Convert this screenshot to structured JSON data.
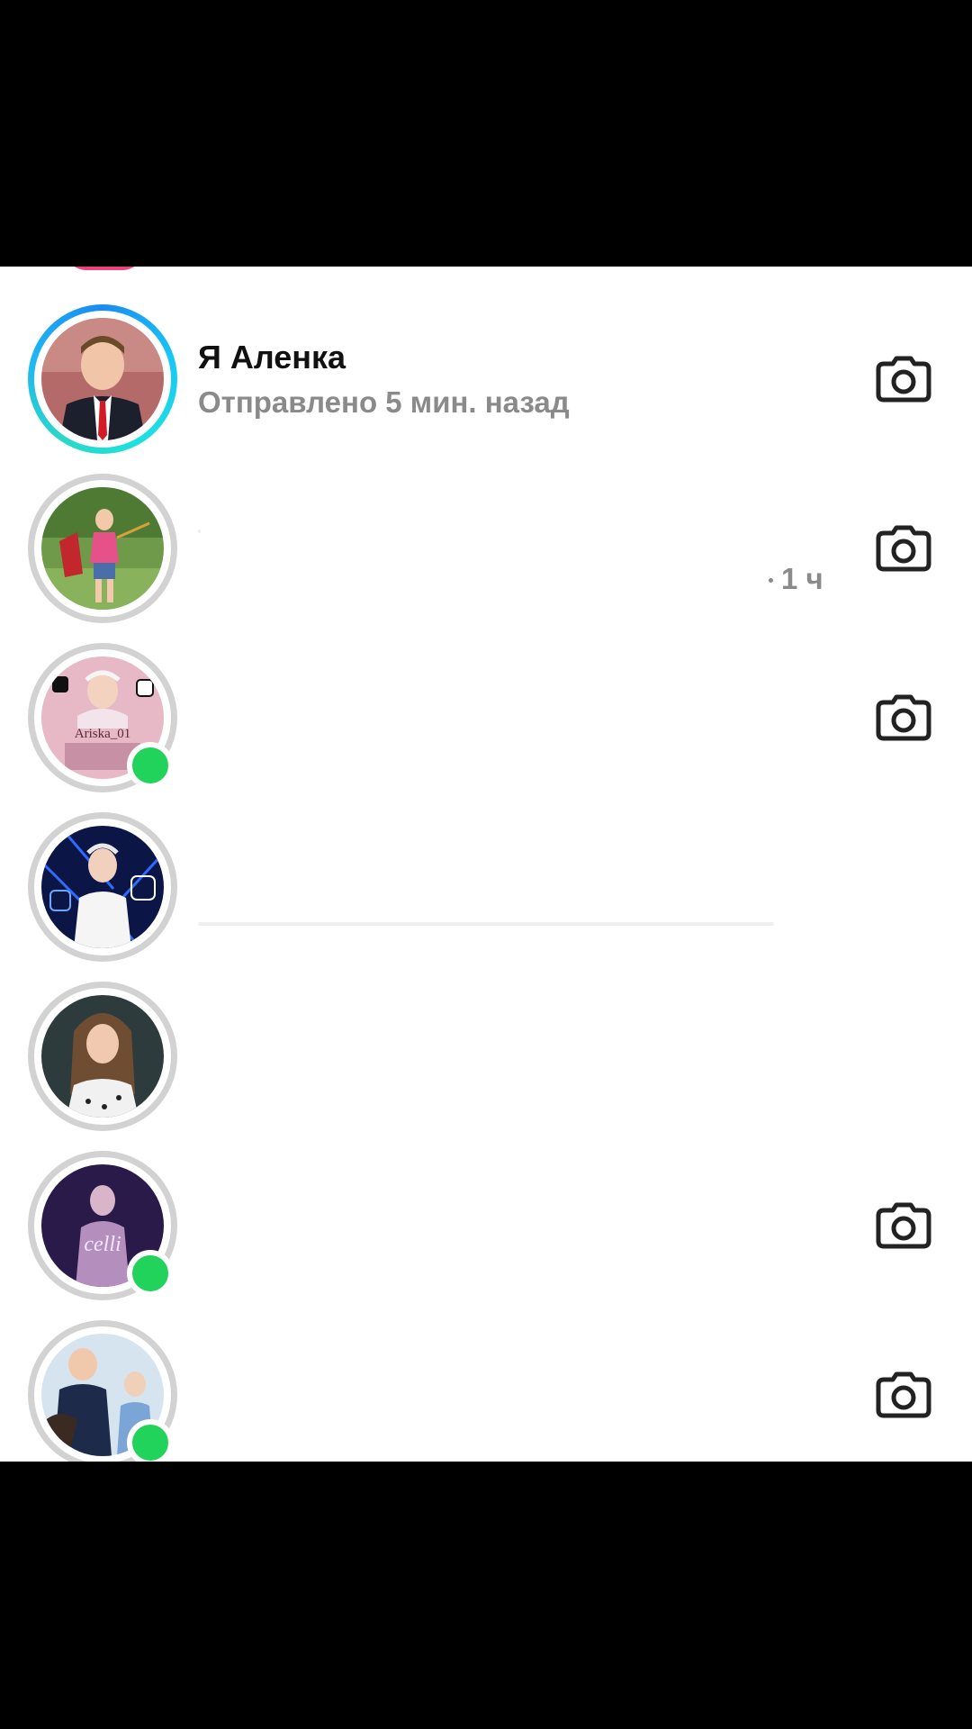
{
  "chats": [
    {
      "name": "Я Аленка",
      "status": "Отправлено 5 мин. назад",
      "time": "",
      "ring": "story",
      "online": false,
      "camera": true,
      "avatar_icon": "boy-in-suit-photo"
    },
    {
      "name": "",
      "status": "",
      "time": "1 ч",
      "ring": "grey",
      "online": false,
      "camera": true,
      "avatar_icon": "girl-archery-photo"
    },
    {
      "name": "",
      "status": "",
      "time": "",
      "ring": "grey",
      "online": true,
      "camera": true,
      "avatar_icon": "pink-edit-photo",
      "avatar_overlay_text": "Ariska_01"
    },
    {
      "name": "",
      "status": "",
      "time": "",
      "ring": "grey",
      "online": false,
      "camera": false,
      "avatar_icon": "blue-neon-edit-photo"
    },
    {
      "name": "",
      "status": "",
      "time": "",
      "ring": "grey",
      "online": false,
      "camera": false,
      "avatar_icon": "girl-portrait-photo"
    },
    {
      "name": "",
      "status": "",
      "time": "",
      "ring": "grey",
      "online": true,
      "camera": true,
      "avatar_icon": "purple-edit-photo",
      "avatar_overlay_text": "celli"
    },
    {
      "name": "",
      "status": "",
      "time": "",
      "ring": "grey",
      "online": true,
      "camera": true,
      "avatar_icon": "children-group-photo"
    }
  ],
  "colors": {
    "online": "#21d35a",
    "story_ring_start": "#1a8cf0",
    "story_ring_end": "#1ee0e0",
    "muted_text": "#8a8a8a",
    "peek_avatar": "#f0427e"
  },
  "icons": {
    "camera": "camera-icon"
  }
}
